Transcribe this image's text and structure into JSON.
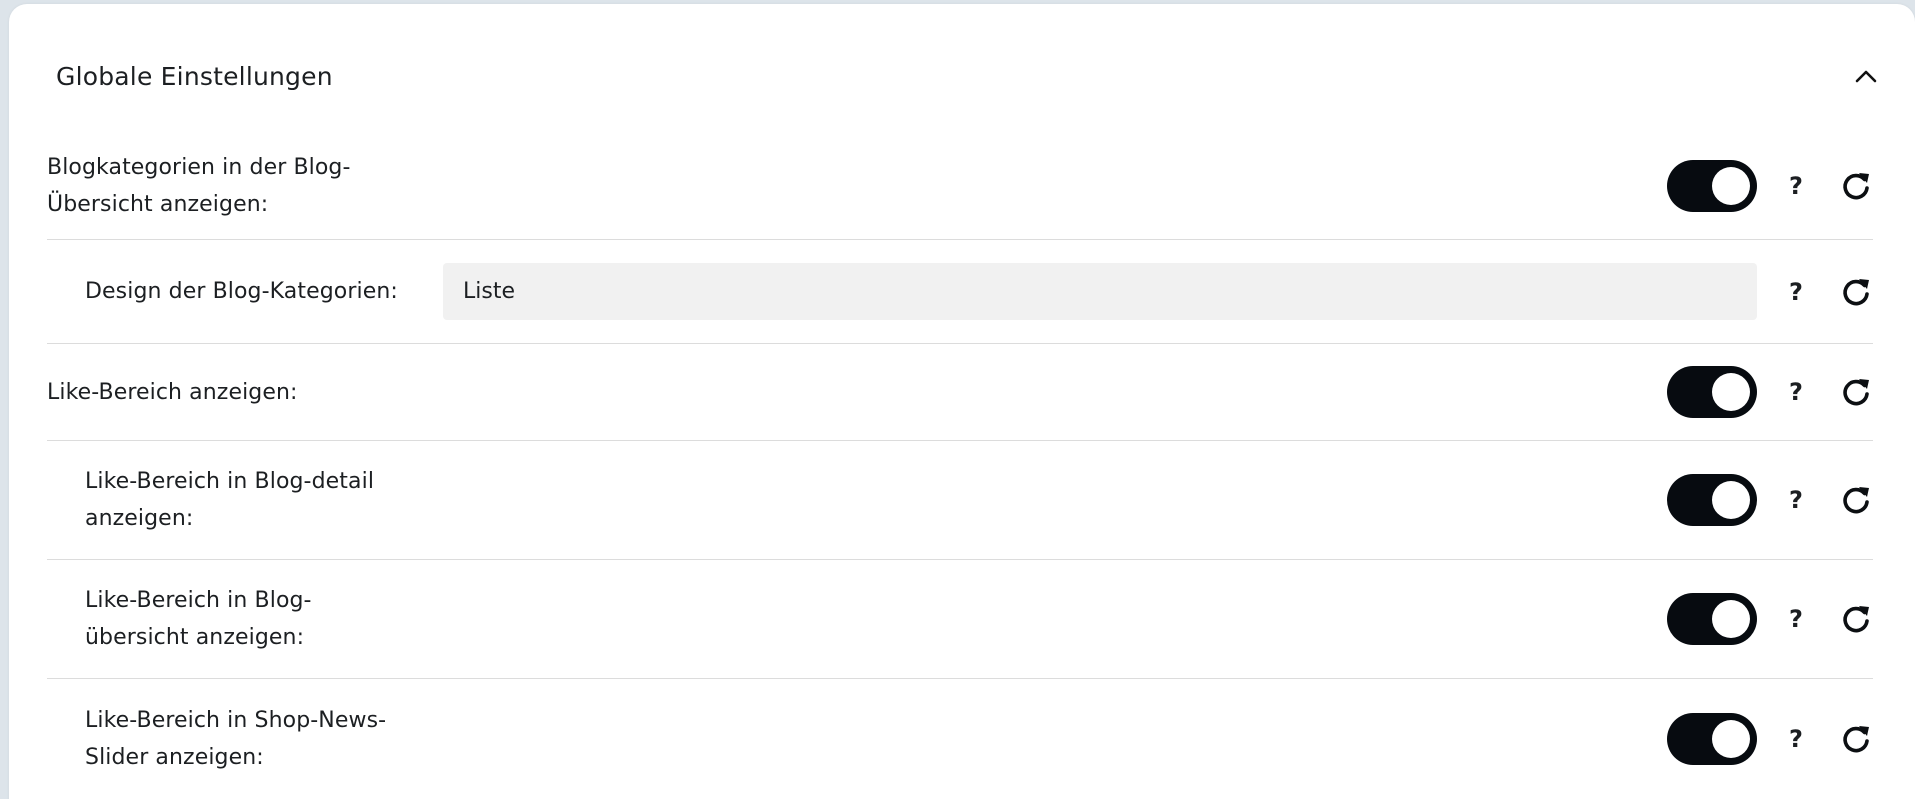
{
  "section": {
    "title": "Globale Einstellungen"
  },
  "settings": [
    {
      "label_line1": "Blogkategorien in der Blog-",
      "label_line2": "Übersicht anzeigen:",
      "type": "toggle",
      "enabled": true
    },
    {
      "label_line1": "Design der Blog-Kategorien:",
      "type": "select",
      "value": "Liste"
    },
    {
      "label_line1": "Like-Bereich anzeigen:",
      "type": "toggle",
      "enabled": true
    },
    {
      "label_line1": "Like-Bereich in Blog-detail",
      "label_line2": "anzeigen:",
      "type": "toggle",
      "enabled": true
    },
    {
      "label_line1": "Like-Bereich in Blog-",
      "label_line2": "übersicht anzeigen:",
      "type": "toggle",
      "enabled": true
    },
    {
      "label_line1": "Like-Bereich in Shop-News-",
      "label_line2": "Slider anzeigen:",
      "type": "toggle",
      "enabled": true
    }
  ],
  "help_label": "?",
  "colors": {
    "toggle_on": "#070b10",
    "background": "#dde4ea",
    "select_bg": "#f1f1f1"
  },
  "icons": {
    "collapse": "chevron-up-icon",
    "reset": "reset-icon",
    "help": "help-icon"
  }
}
